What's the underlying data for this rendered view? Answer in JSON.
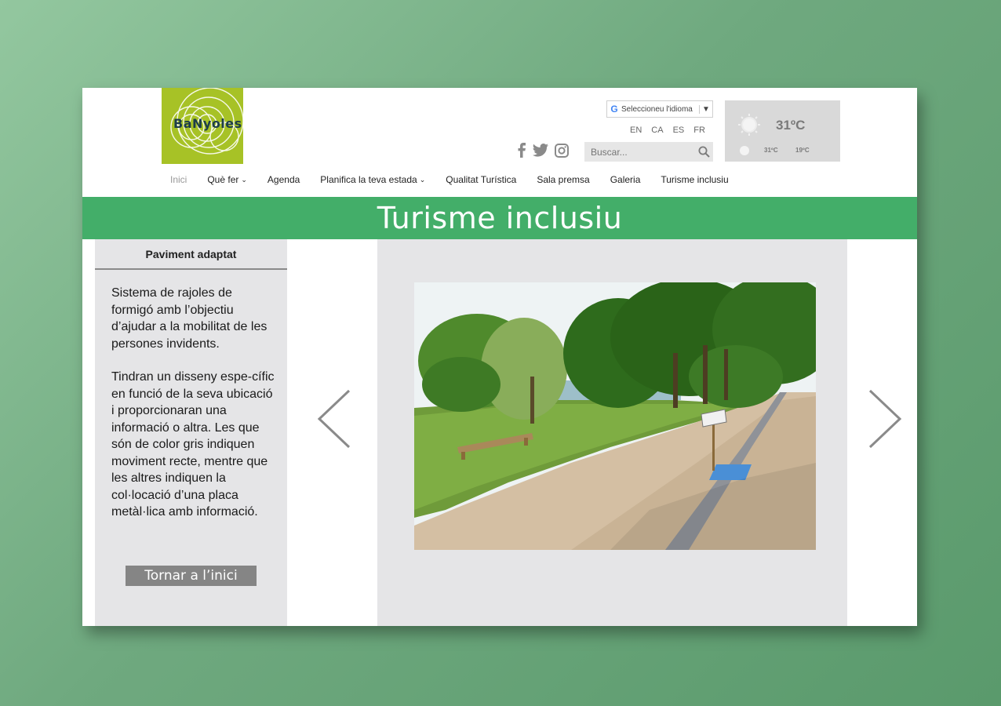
{
  "logo": {
    "text": "BaNyoles",
    "color": "#a7c226"
  },
  "language_selector": {
    "label": "Seleccioneu l'idioma",
    "google_mark": "G",
    "arrow": "▼"
  },
  "languages": [
    "EN",
    "CA",
    "ES",
    "FR"
  ],
  "socials": [
    "facebook-icon",
    "twitter-icon",
    "instagram-icon"
  ],
  "search": {
    "placeholder": "Buscar..."
  },
  "weather": {
    "current": "31ºC",
    "high": "31ºC",
    "low": "19ºC"
  },
  "nav": [
    {
      "label": "Inici",
      "active": true,
      "dropdown": false
    },
    {
      "label": "Què fer",
      "active": false,
      "dropdown": true
    },
    {
      "label": "Agenda",
      "active": false,
      "dropdown": false
    },
    {
      "label": "Planifica la teva estada",
      "active": false,
      "dropdown": true
    },
    {
      "label": "Qualitat Turística",
      "active": false,
      "dropdown": false
    },
    {
      "label": "Sala premsa",
      "active": false,
      "dropdown": false
    },
    {
      "label": "Galeria",
      "active": false,
      "dropdown": false
    },
    {
      "label": "Turisme inclusiu",
      "active": false,
      "dropdown": false
    }
  ],
  "banner": {
    "title": "Turisme inclusiu",
    "color": "#43ae69"
  },
  "sidebar": {
    "title": "Paviment adaptat",
    "paragraph1": "Sistema de rajoles de formigó amb l’objectiu d’ajudar a la mobilitat de les persones invidents.",
    "paragraph2": "Tindran un disseny espe-cífic en funció de la seva ubicació i proporcionaran una informació o altra. Les que són de color gris indiquen moviment recte, mentre que les altres indiquen la col·locació d’una placa metàl·lica amb informació.",
    "button": "Tornar a l’inici"
  }
}
